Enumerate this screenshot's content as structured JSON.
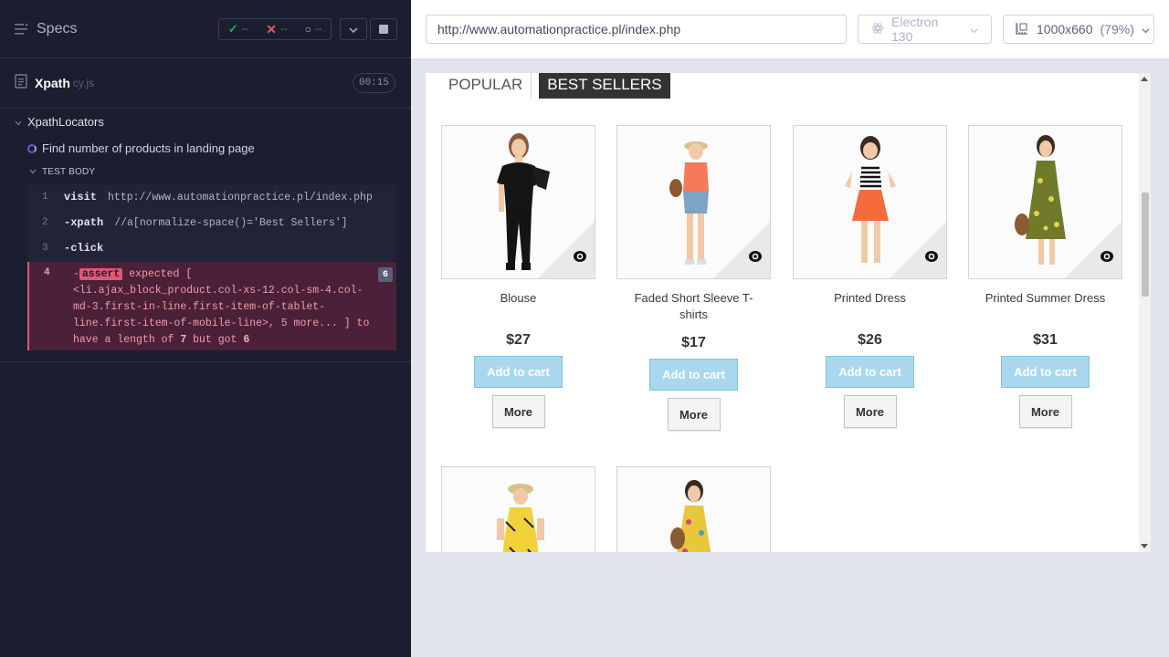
{
  "reporter": {
    "specs_label": "Specs",
    "stats": {
      "passed": "--",
      "failed": "--",
      "pending": "--"
    },
    "spec": {
      "name": "Xpath",
      "ext": "cy.js",
      "duration": "00:15"
    },
    "suite": "XpathLocators",
    "test_title": "Find number of products in landing page",
    "test_body_label": "TEST BODY",
    "commands": [
      {
        "num": "1",
        "name": "visit",
        "message": "http://www.automationpractice.pl/index.php"
      },
      {
        "num": "2",
        "name": "-xpath",
        "message": "//a[normalize-space()='Best Sellers']"
      },
      {
        "num": "3",
        "name": "-click",
        "message": ""
      }
    ],
    "failed_command": {
      "num": "4",
      "prefix": "-",
      "tag": "assert",
      "line1": " expected [",
      "line2": "<li.ajax_block_product.col-xs-12.col-sm-4.col-md-3.first-in-line.first-item-of-tablet-line.first-item-of-mobile-line>, 5 more... ]",
      "to_have": " to have a length of ",
      "expected_len": "7",
      "but_got": " but got ",
      "actual_len": "6",
      "badge": "6"
    }
  },
  "aut_header": {
    "url": "http://www.automationpractice.pl/index.php",
    "browser": "Electron 130",
    "viewport": "1000x660",
    "scale": "(79%)"
  },
  "aut": {
    "tabs": {
      "popular": "POPULAR",
      "best": "BEST SELLERS"
    },
    "add_to_cart": "Add to cart",
    "more": "More",
    "products": [
      {
        "name": "Blouse",
        "price": "$27"
      },
      {
        "name": "Faded Short Sleeve T-shirts",
        "price": "$17"
      },
      {
        "name": "Printed Dress",
        "price": "$26"
      },
      {
        "name": "Printed Summer Dress",
        "price": "$31"
      }
    ]
  }
}
